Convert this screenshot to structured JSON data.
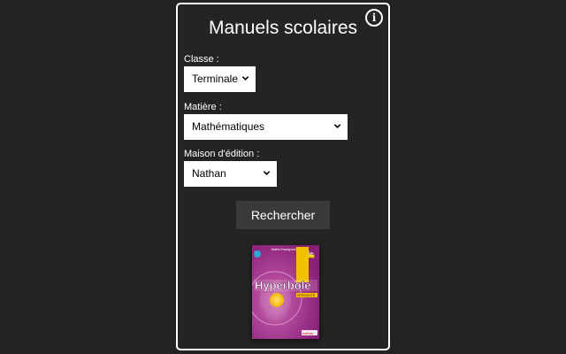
{
  "header": {
    "title": "Manuels scolaires",
    "info_icon": "info-circle-icon"
  },
  "form": {
    "classe": {
      "label": "Classe :",
      "value": "Terminale"
    },
    "matiere": {
      "label": "Matière :",
      "value": "Mathématiques"
    },
    "editeur": {
      "label": "Maison d'édition :",
      "value": "Nathan"
    },
    "search_button": "Rechercher"
  },
  "result": {
    "cover_title": "Hyperbole",
    "cover_grade": "T",
    "cover_grade_suffix": "le",
    "cover_series": "Maths Enseignement",
    "cover_tag": "SPÉCIALITÉ",
    "publisher_mark": "nathan"
  },
  "colors": {
    "background": "#232323",
    "panel_border": "#ffffff",
    "button_bg": "#3a3a3a",
    "cover_magenta": "#9b2a86",
    "cover_yellow": "#f2c200"
  }
}
